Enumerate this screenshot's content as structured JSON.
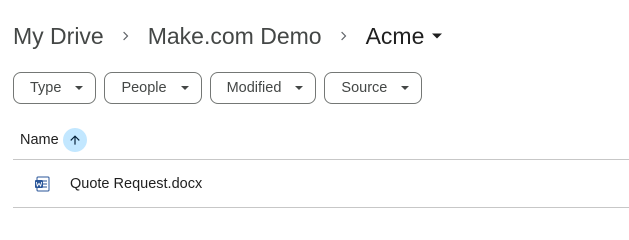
{
  "breadcrumb": {
    "items": [
      {
        "label": "My Drive"
      },
      {
        "label": "Make.com Demo"
      },
      {
        "label": "Acme"
      }
    ],
    "separator_icon": "chevron-right-icon",
    "current_menu_icon": "caret-down-icon"
  },
  "filters": [
    {
      "label": "Type"
    },
    {
      "label": "People"
    },
    {
      "label": "Modified"
    },
    {
      "label": "Source"
    }
  ],
  "list": {
    "columns": [
      {
        "label": "Name",
        "sort": "ascending",
        "sort_icon": "arrow-up-icon"
      }
    ],
    "rows": [
      {
        "name": "Quote Request.docx",
        "icon": "word-doc-icon"
      }
    ]
  },
  "colors": {
    "sort_highlight": "#c2e7ff",
    "word_blue": "#2a5699",
    "divider": "#c7c7c7"
  }
}
